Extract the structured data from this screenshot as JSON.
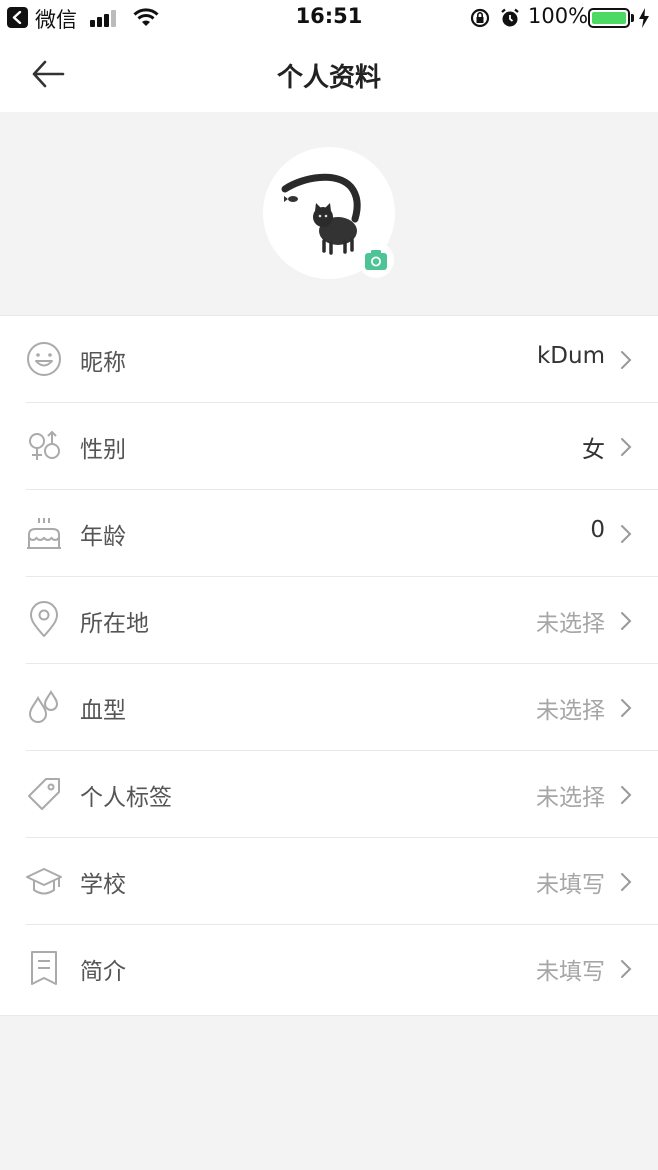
{
  "status_bar": {
    "app_name": "微信",
    "time": "16:51",
    "battery_percent": "100%",
    "battery_level": 1.0,
    "battery_color": "#4cd964"
  },
  "nav": {
    "title": "个人资料",
    "back_icon": "arrow-left-icon"
  },
  "avatar": {
    "icon": "cat-avatar-image",
    "badge_icon": "camera-icon",
    "badge_color": "#4cc495"
  },
  "rows": [
    {
      "icon": "smiley-face-icon",
      "label": "昵称",
      "value": "kDum",
      "state": "set"
    },
    {
      "icon": "gender-icon",
      "label": "性别",
      "value": "女",
      "state": "set"
    },
    {
      "icon": "birthday-cake-icon",
      "label": "年龄",
      "value": "0",
      "state": "set"
    },
    {
      "icon": "location-pin-icon",
      "label": "所在地",
      "value": "未选择",
      "state": "unset"
    },
    {
      "icon": "blood-drop-icon",
      "label": "血型",
      "value": "未选择",
      "state": "unset"
    },
    {
      "icon": "tag-icon",
      "label": "个人标签",
      "value": "未选择",
      "state": "unset"
    },
    {
      "icon": "graduation-cap-icon",
      "label": "学校",
      "value": "未填写",
      "state": "unset"
    },
    {
      "icon": "bookmark-note-icon",
      "label": "简介",
      "value": "未填写",
      "state": "unset"
    }
  ]
}
